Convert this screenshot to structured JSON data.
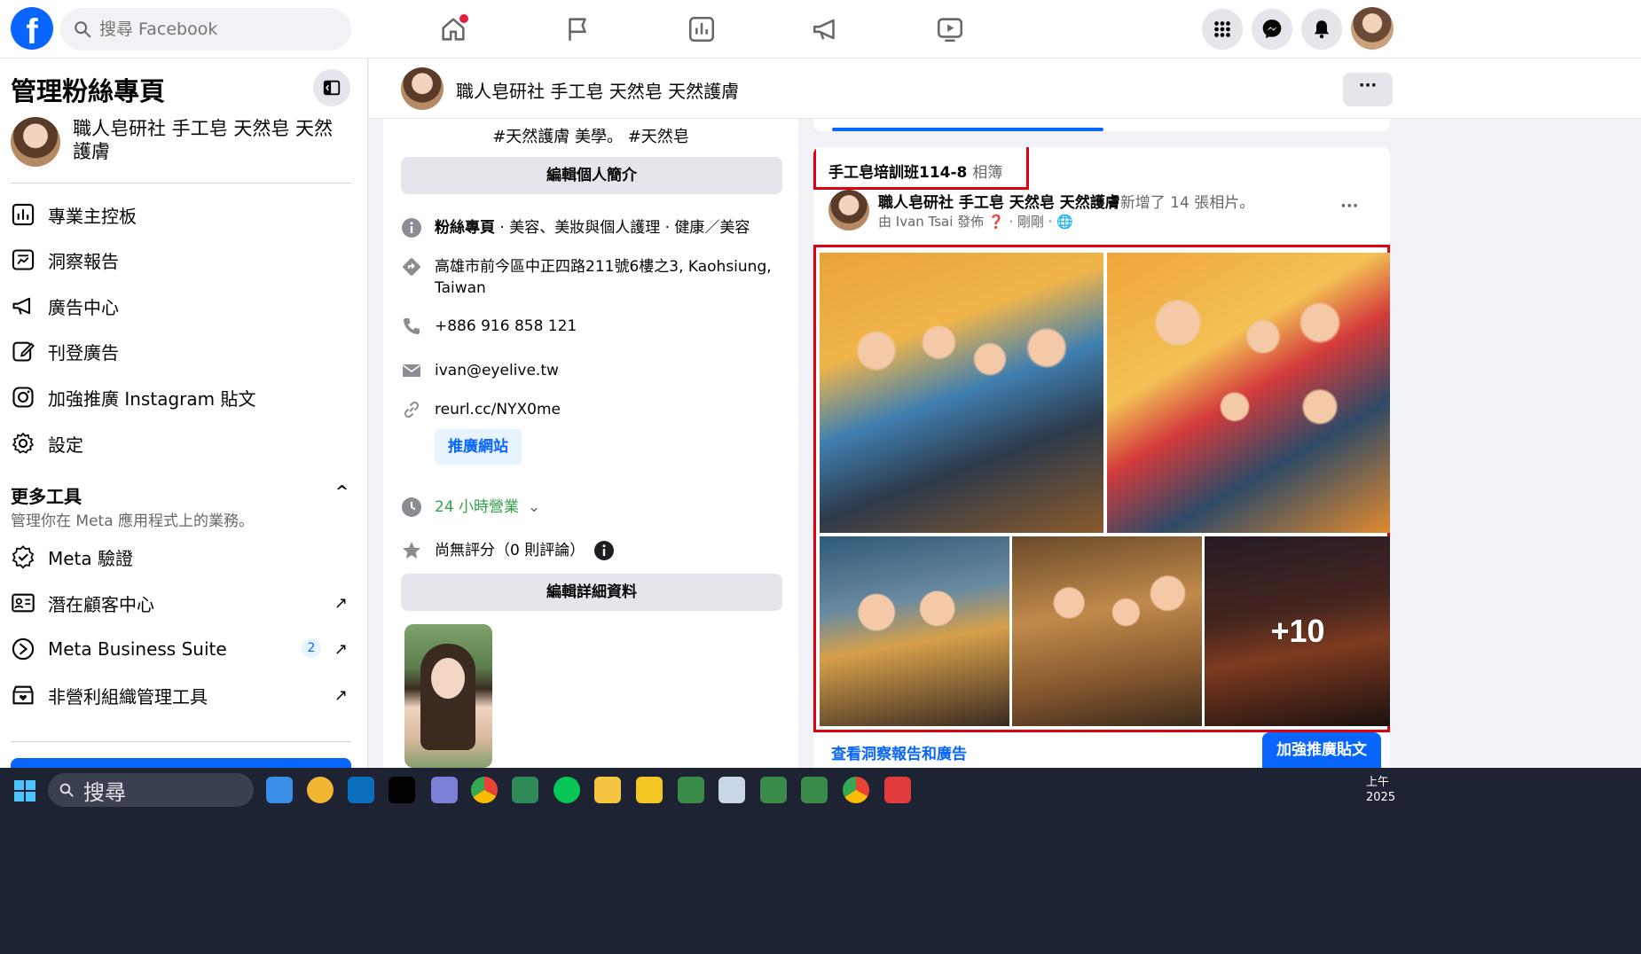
{
  "topbar": {
    "logo": "f",
    "search_placeholder": "搜尋 Facebook",
    "nav_icons": [
      "home-icon",
      "flag-icon",
      "insights-icon",
      "megaphone-icon",
      "video-icon"
    ],
    "right_icons": [
      "menu-grid-icon",
      "messenger-icon",
      "bell-icon"
    ]
  },
  "sidebar": {
    "title": "管理粉絲專頁",
    "page_name": "職人皂研社 手工皂 天然皂 天然護膚",
    "items": [
      {
        "label": "專業主控板",
        "icon": "dashboard-icon"
      },
      {
        "label": "洞察報告",
        "icon": "insights-report-icon"
      },
      {
        "label": "廣告中心",
        "icon": "megaphone-icon"
      },
      {
        "label": "刊登廣告",
        "icon": "edit-ad-icon"
      },
      {
        "label": "加強推廣 Instagram 貼文",
        "icon": "instagram-icon"
      },
      {
        "label": "設定",
        "icon": "gear-icon"
      }
    ],
    "more_tools_title": "更多工具",
    "more_tools_subtitle": "管理你在 Meta 應用程式上的業務。",
    "tools": [
      {
        "label": "Meta 驗證",
        "icon": "verified-icon",
        "arrow": ""
      },
      {
        "label": "潛在顧客中心",
        "icon": "leads-icon",
        "arrow": "↗"
      },
      {
        "label": "Meta Business Suite",
        "icon": "business-suite-icon",
        "arrow": "↗",
        "badge": "2"
      },
      {
        "label": "非營利組織管理工具",
        "icon": "nonprofit-icon",
        "arrow": "↗"
      }
    ]
  },
  "page_header": {
    "name": "職人皂研社 手工皂 天然皂 天然護膚",
    "more": "···"
  },
  "intro": {
    "hashtags": "#天然護膚 美學。 #天然皂",
    "edit_bio_button": "編輯個人簡介",
    "category_label": "粉絲專頁",
    "category_text": " · 美容、美妝與個人護理 · 健康／美容",
    "address": "高雄市前今區中正四路211號6樓之3, Kaohsiung, Taiwan",
    "phone": "+886 916 858 121",
    "email": "ivan@eyelive.tw",
    "website": "reurl.cc/NYX0me",
    "promote_website_button": "推廣網站",
    "hours": "24 小時營業",
    "rating": "尚無評分（0 則評論）",
    "edit_details_button": "編輯詳細資料"
  },
  "post": {
    "album_title": "手工皂培訓班114-8",
    "album_suffix": "相簿",
    "poster_name": "職人皂研社 手工皂 天然皂 天然護膚",
    "poster_action": "新增了 14 張相片。",
    "poster_sub": "由 Ivan Tsai 發佈 ❓ · 剛剛 · 🌐",
    "more": "···",
    "more_photos": "+10",
    "insights_link": "查看洞察報告和廣告",
    "boost_button": "加強推廣貼文"
  },
  "taskbar": {
    "search_label": "搜尋",
    "clock_line1": "上午",
    "clock_line2": "2025"
  },
  "colors": {
    "brand_blue": "#0866ff",
    "highlight_red": "#e0000f",
    "notification_red": "#e41e3f",
    "hours_green": "#31a24c"
  }
}
